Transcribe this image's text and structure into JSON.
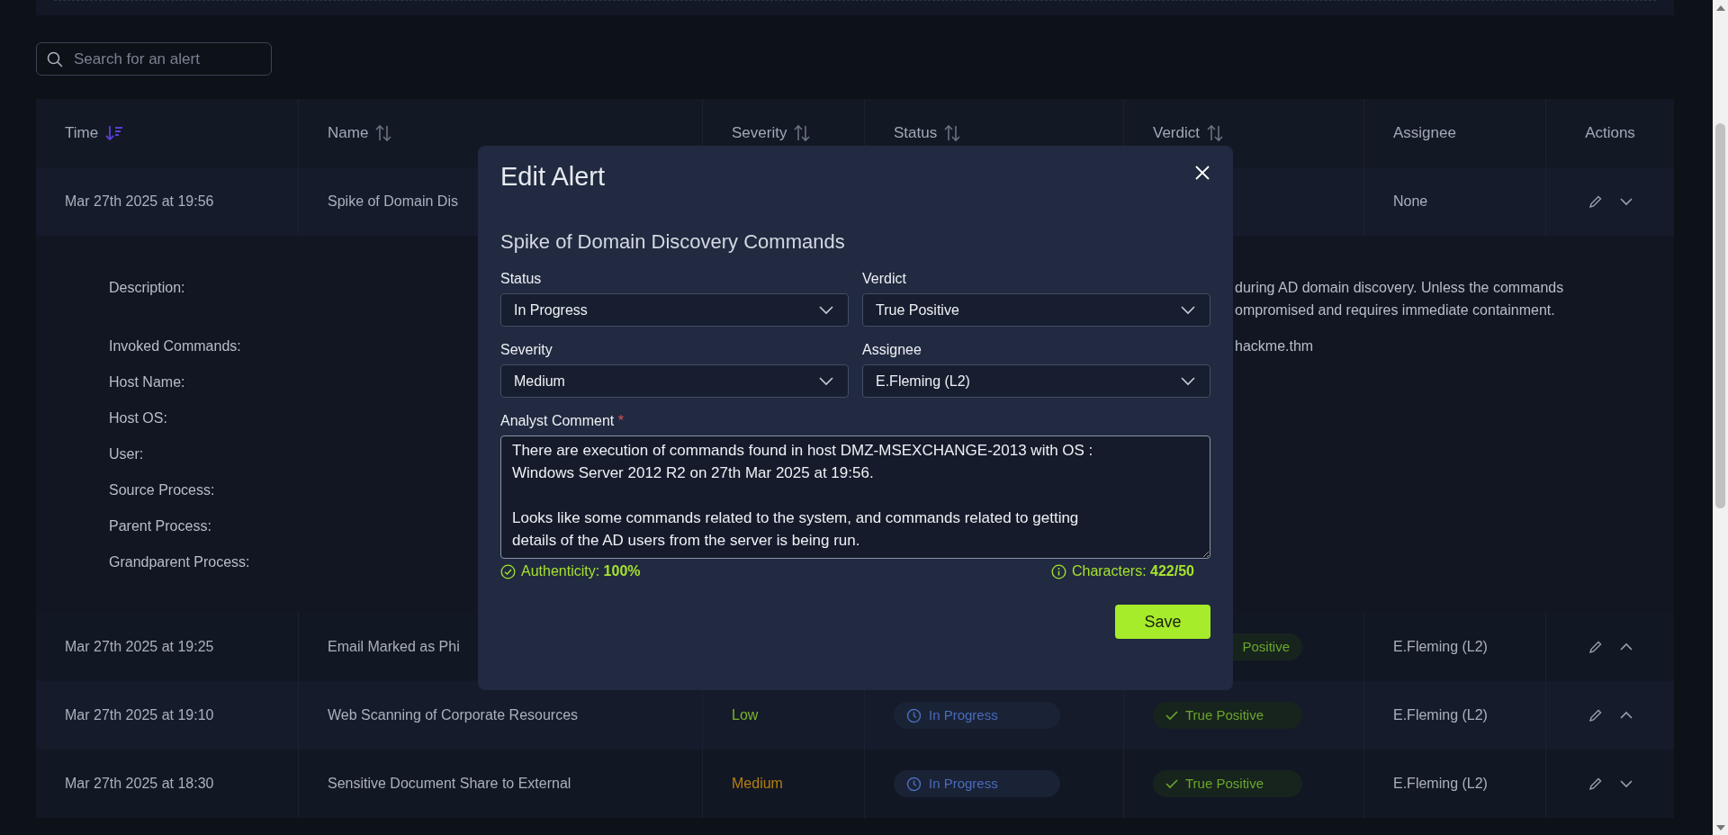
{
  "search": {
    "placeholder": "Search for an alert"
  },
  "table": {
    "columns": [
      {
        "label": "Time",
        "sorted": true
      },
      {
        "label": "Name",
        "sorted": false
      },
      {
        "label": "Severity",
        "sorted": false
      },
      {
        "label": "Status",
        "sorted": false
      },
      {
        "label": "Verdict",
        "sorted": false
      },
      {
        "label": "Assignee"
      },
      {
        "label": "Actions"
      }
    ],
    "rows": [
      {
        "time": "Mar 27th 2025 at 19:56",
        "name": "Spike of Domain Dis",
        "assignee": "None",
        "expanded": false,
        "details": [
          {
            "label": "Description:",
            "value_lines": [
              "during AD domain discovery. Unless the commands",
              "ompromised and requires immediate containment."
            ]
          },
          {
            "label": "Invoked Commands:",
            "value_lines": [
              "hackme.thm"
            ]
          },
          {
            "label": "Host Name:"
          },
          {
            "label": "Host OS:"
          },
          {
            "label": "User:"
          },
          {
            "label": "Source Process:"
          },
          {
            "label": "Parent Process:"
          },
          {
            "label": "Grandparent Process:"
          }
        ]
      },
      {
        "time": "Mar 27th 2025 at 19:25",
        "name": "Email Marked as Phi",
        "verdict": {
          "text": "Positive",
          "kind": "true_positive",
          "icon": false
        },
        "assignee": "E.Fleming (L2)",
        "expanded": true
      },
      {
        "time": "Mar 27th 2025 at 19:10",
        "name": "Web Scanning of Corporate Resources",
        "severity": {
          "text": "Low",
          "kind": "low"
        },
        "status": {
          "text": "In Progress",
          "kind": "in_progress"
        },
        "verdict": {
          "text": "True Positive",
          "kind": "true_positive",
          "icon": true
        },
        "assignee": "E.Fleming (L2)",
        "expanded": true
      },
      {
        "time": "Mar 27th 2025 at 18:30",
        "name": "Sensitive Document Share to External",
        "severity": {
          "text": "Medium",
          "kind": "medium"
        },
        "status": {
          "text": "In Progress",
          "kind": "in_progress"
        },
        "verdict": {
          "text": "True Positive",
          "kind": "true_positive",
          "icon": true
        },
        "assignee": "E.Fleming (L2)",
        "expanded": false
      }
    ]
  },
  "dialog": {
    "title": "Edit Alert",
    "alert_name": "Spike of Domain Discovery Commands",
    "fields": [
      {
        "label": "Status",
        "value": "In Progress"
      },
      {
        "label": "Verdict",
        "value": "True Positive"
      },
      {
        "label": "Severity",
        "value": "Medium"
      },
      {
        "label": "Assignee",
        "value": "E.Fleming (L2)"
      }
    ],
    "comment": {
      "label": "Analyst Comment",
      "required_mark": "*",
      "value": "There are execution of commands found in host DMZ-MSEXCHANGE-2013 with OS : Windows Server 2012 R2 on 27th Mar 2025 at 19:56.\n\nLooks like some commands related to the system, and commands related to getting details of the AD users from the server is being run."
    },
    "authenticity": "Authenticity: **100%**",
    "characters": "Characters: **422/50**",
    "save": "Save"
  }
}
